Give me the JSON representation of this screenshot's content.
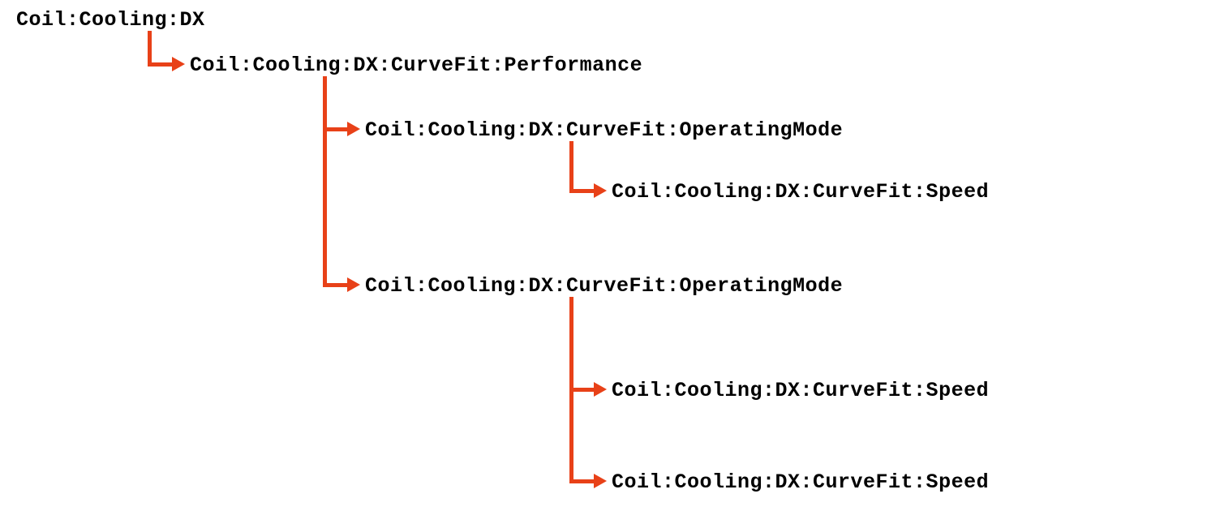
{
  "nodes": {
    "root": "Coil:Cooling:DX",
    "performance": "Coil:Cooling:DX:CurveFit:Performance",
    "opmode1": "Coil:Cooling:DX:CurveFit:OperatingMode",
    "speed1": "Coil:Cooling:DX:CurveFit:Speed",
    "opmode2": "Coil:Cooling:DX:CurveFit:OperatingMode",
    "speed2": "Coil:Cooling:DX:CurveFit:Speed",
    "speed3": "Coil:Cooling:DX:CurveFit:Speed"
  },
  "color": "#e84118"
}
